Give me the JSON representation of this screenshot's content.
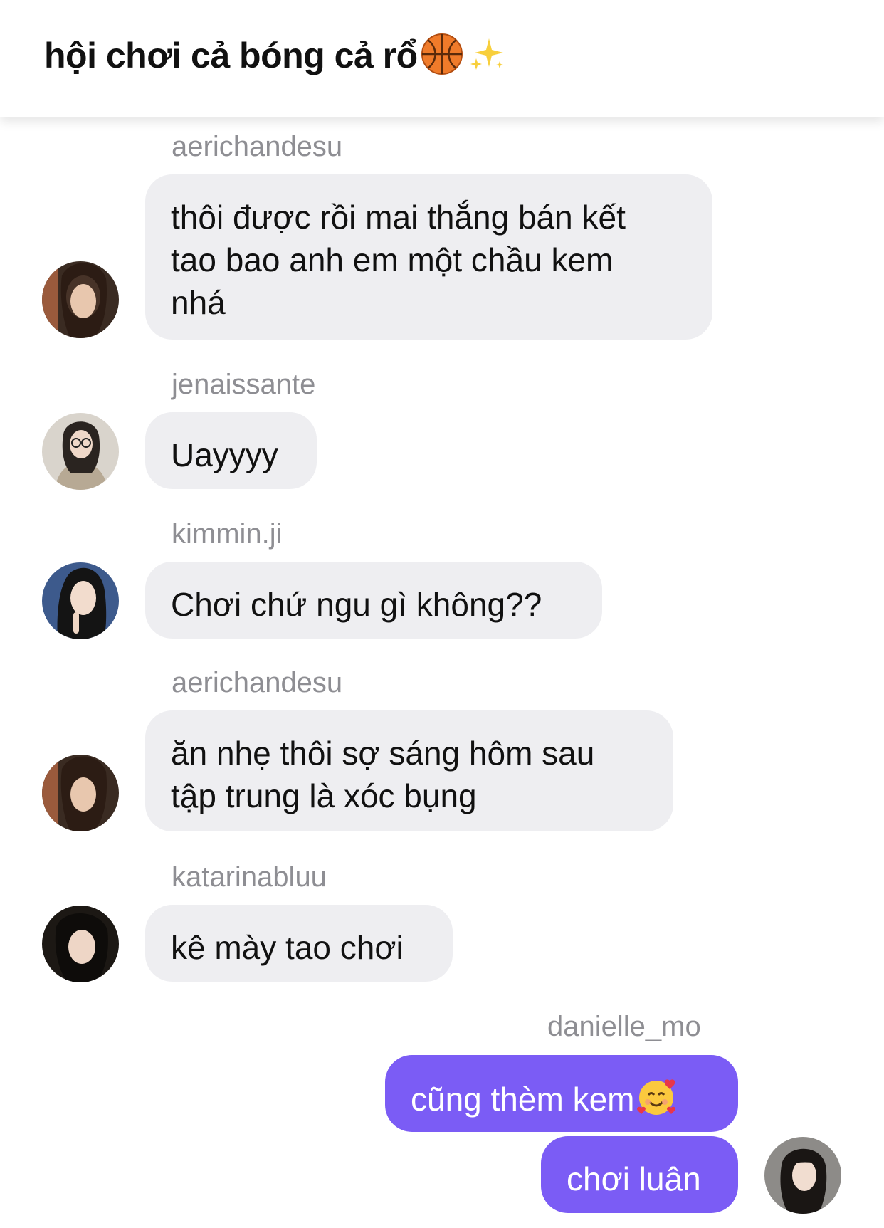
{
  "header": {
    "title": "hội chơi cả bóng cả rổ",
    "title_emoji_1": "basketball-emoji",
    "title_emoji_2": "sparkles-emoji"
  },
  "colors": {
    "incoming_bubble": "#eeeef1",
    "outgoing_bubble": "#7b5cf5",
    "sender_name": "#8e8e93"
  },
  "messages": [
    {
      "sender": "aerichandesu",
      "lines": [
        "thôi được rồi mai thắng bán kết",
        "tao bao anh em một chầu kem",
        "nhá"
      ],
      "direction": "incoming"
    },
    {
      "sender": "jenaissante",
      "lines": [
        "Uayyyy"
      ],
      "direction": "incoming"
    },
    {
      "sender": "kimmin.ji",
      "lines": [
        "Chơi chứ ngu gì không??"
      ],
      "direction": "incoming"
    },
    {
      "sender": "aerichandesu",
      "lines": [
        "ăn nhẹ thôi sợ sáng hôm sau",
        "tập trung là xóc bụng"
      ],
      "direction": "incoming"
    },
    {
      "sender": "katarinabluu",
      "lines": [
        "kê mày tao chơi"
      ],
      "direction": "incoming"
    },
    {
      "sender": "danielle_mo",
      "lines": [
        "cũng thèm kem"
      ],
      "emoji": "smiling-face-with-hearts-emoji",
      "direction": "outgoing"
    },
    {
      "sender": "",
      "lines": [
        "chơi luân"
      ],
      "direction": "outgoing"
    }
  ]
}
